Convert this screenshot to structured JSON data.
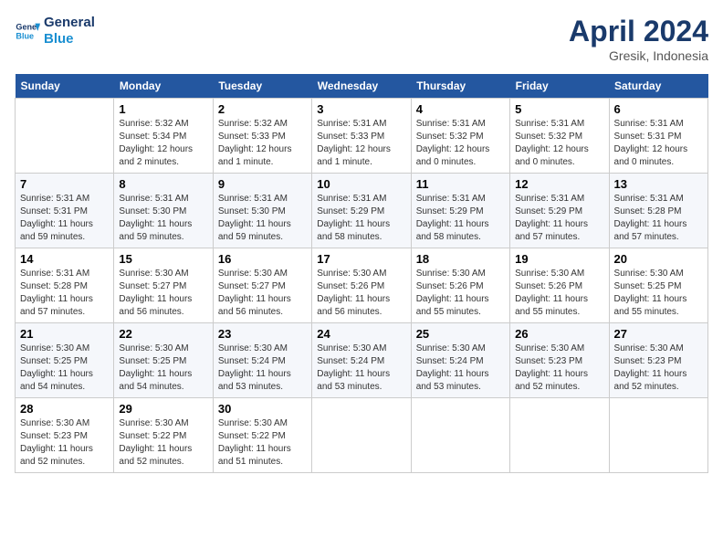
{
  "header": {
    "logo_line1": "General",
    "logo_line2": "Blue",
    "month": "April 2024",
    "location": "Gresik, Indonesia"
  },
  "days_of_week": [
    "Sunday",
    "Monday",
    "Tuesday",
    "Wednesday",
    "Thursday",
    "Friday",
    "Saturday"
  ],
  "weeks": [
    [
      {
        "day": "",
        "info": ""
      },
      {
        "day": "1",
        "info": "Sunrise: 5:32 AM\nSunset: 5:34 PM\nDaylight: 12 hours\nand 2 minutes."
      },
      {
        "day": "2",
        "info": "Sunrise: 5:32 AM\nSunset: 5:33 PM\nDaylight: 12 hours\nand 1 minute."
      },
      {
        "day": "3",
        "info": "Sunrise: 5:31 AM\nSunset: 5:33 PM\nDaylight: 12 hours\nand 1 minute."
      },
      {
        "day": "4",
        "info": "Sunrise: 5:31 AM\nSunset: 5:32 PM\nDaylight: 12 hours\nand 0 minutes."
      },
      {
        "day": "5",
        "info": "Sunrise: 5:31 AM\nSunset: 5:32 PM\nDaylight: 12 hours\nand 0 minutes."
      },
      {
        "day": "6",
        "info": "Sunrise: 5:31 AM\nSunset: 5:31 PM\nDaylight: 12 hours\nand 0 minutes."
      }
    ],
    [
      {
        "day": "7",
        "info": "Sunrise: 5:31 AM\nSunset: 5:31 PM\nDaylight: 11 hours\nand 59 minutes."
      },
      {
        "day": "8",
        "info": "Sunrise: 5:31 AM\nSunset: 5:30 PM\nDaylight: 11 hours\nand 59 minutes."
      },
      {
        "day": "9",
        "info": "Sunrise: 5:31 AM\nSunset: 5:30 PM\nDaylight: 11 hours\nand 59 minutes."
      },
      {
        "day": "10",
        "info": "Sunrise: 5:31 AM\nSunset: 5:29 PM\nDaylight: 11 hours\nand 58 minutes."
      },
      {
        "day": "11",
        "info": "Sunrise: 5:31 AM\nSunset: 5:29 PM\nDaylight: 11 hours\nand 58 minutes."
      },
      {
        "day": "12",
        "info": "Sunrise: 5:31 AM\nSunset: 5:29 PM\nDaylight: 11 hours\nand 57 minutes."
      },
      {
        "day": "13",
        "info": "Sunrise: 5:31 AM\nSunset: 5:28 PM\nDaylight: 11 hours\nand 57 minutes."
      }
    ],
    [
      {
        "day": "14",
        "info": "Sunrise: 5:31 AM\nSunset: 5:28 PM\nDaylight: 11 hours\nand 57 minutes."
      },
      {
        "day": "15",
        "info": "Sunrise: 5:30 AM\nSunset: 5:27 PM\nDaylight: 11 hours\nand 56 minutes."
      },
      {
        "day": "16",
        "info": "Sunrise: 5:30 AM\nSunset: 5:27 PM\nDaylight: 11 hours\nand 56 minutes."
      },
      {
        "day": "17",
        "info": "Sunrise: 5:30 AM\nSunset: 5:26 PM\nDaylight: 11 hours\nand 56 minutes."
      },
      {
        "day": "18",
        "info": "Sunrise: 5:30 AM\nSunset: 5:26 PM\nDaylight: 11 hours\nand 55 minutes."
      },
      {
        "day": "19",
        "info": "Sunrise: 5:30 AM\nSunset: 5:26 PM\nDaylight: 11 hours\nand 55 minutes."
      },
      {
        "day": "20",
        "info": "Sunrise: 5:30 AM\nSunset: 5:25 PM\nDaylight: 11 hours\nand 55 minutes."
      }
    ],
    [
      {
        "day": "21",
        "info": "Sunrise: 5:30 AM\nSunset: 5:25 PM\nDaylight: 11 hours\nand 54 minutes."
      },
      {
        "day": "22",
        "info": "Sunrise: 5:30 AM\nSunset: 5:25 PM\nDaylight: 11 hours\nand 54 minutes."
      },
      {
        "day": "23",
        "info": "Sunrise: 5:30 AM\nSunset: 5:24 PM\nDaylight: 11 hours\nand 53 minutes."
      },
      {
        "day": "24",
        "info": "Sunrise: 5:30 AM\nSunset: 5:24 PM\nDaylight: 11 hours\nand 53 minutes."
      },
      {
        "day": "25",
        "info": "Sunrise: 5:30 AM\nSunset: 5:24 PM\nDaylight: 11 hours\nand 53 minutes."
      },
      {
        "day": "26",
        "info": "Sunrise: 5:30 AM\nSunset: 5:23 PM\nDaylight: 11 hours\nand 52 minutes."
      },
      {
        "day": "27",
        "info": "Sunrise: 5:30 AM\nSunset: 5:23 PM\nDaylight: 11 hours\nand 52 minutes."
      }
    ],
    [
      {
        "day": "28",
        "info": "Sunrise: 5:30 AM\nSunset: 5:23 PM\nDaylight: 11 hours\nand 52 minutes."
      },
      {
        "day": "29",
        "info": "Sunrise: 5:30 AM\nSunset: 5:22 PM\nDaylight: 11 hours\nand 52 minutes."
      },
      {
        "day": "30",
        "info": "Sunrise: 5:30 AM\nSunset: 5:22 PM\nDaylight: 11 hours\nand 51 minutes."
      },
      {
        "day": "",
        "info": ""
      },
      {
        "day": "",
        "info": ""
      },
      {
        "day": "",
        "info": ""
      },
      {
        "day": "",
        "info": ""
      }
    ]
  ]
}
